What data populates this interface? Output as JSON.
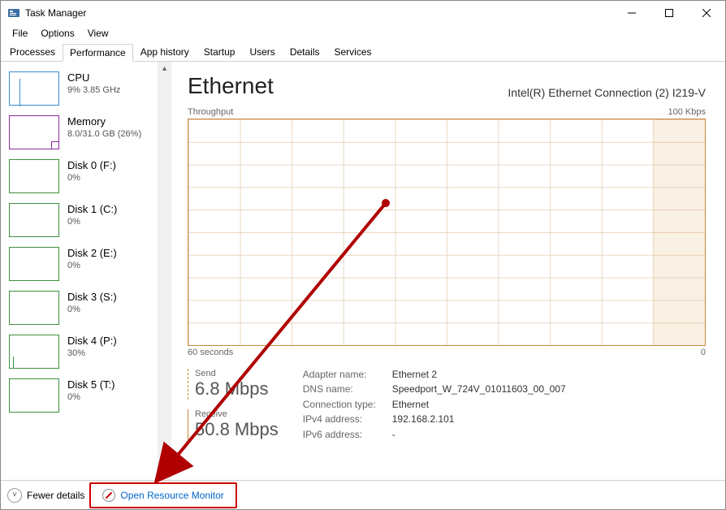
{
  "window": {
    "title": "Task Manager",
    "menus": [
      "File",
      "Options",
      "View"
    ],
    "tabs": [
      "Processes",
      "Performance",
      "App history",
      "Startup",
      "Users",
      "Details",
      "Services"
    ],
    "active_tab": "Performance"
  },
  "sidebar": {
    "items": [
      {
        "title": "CPU",
        "sub": "9% 3.85 GHz",
        "kind": "cpu"
      },
      {
        "title": "Memory",
        "sub": "8.0/31.0 GB (26%)",
        "kind": "mem"
      },
      {
        "title": "Disk 0 (F:)",
        "sub": "0%",
        "kind": "disk"
      },
      {
        "title": "Disk 1 (C:)",
        "sub": "0%",
        "kind": "disk"
      },
      {
        "title": "Disk 2 (E:)",
        "sub": "0%",
        "kind": "disk"
      },
      {
        "title": "Disk 3 (S:)",
        "sub": "0%",
        "kind": "disk"
      },
      {
        "title": "Disk 4 (P:)",
        "sub": "30%",
        "kind": "disk4"
      },
      {
        "title": "Disk 5 (T:)",
        "sub": "0%",
        "kind": "disk"
      }
    ]
  },
  "main": {
    "title": "Ethernet",
    "subtitle": "Intel(R) Ethernet Connection (2) I219-V",
    "chart_top_left": "Throughput",
    "chart_top_right": "100 Kbps",
    "chart_bottom_left": "60 seconds",
    "chart_bottom_right": "0",
    "send_label": "Send",
    "send_value": "6.8 Mbps",
    "receive_label": "Receive",
    "receive_value": "50.8 Mbps",
    "details": {
      "adapter_k": "Adapter name:",
      "adapter_v": "Ethernet 2",
      "dns_k": "DNS name:",
      "dns_v": "Speedport_W_724V_01011603_00_007",
      "conn_k": "Connection type:",
      "conn_v": "Ethernet",
      "ipv4_k": "IPv4 address:",
      "ipv4_v": "192.168.2.101",
      "ipv6_k": "IPv6 address:",
      "ipv6_v": "-"
    }
  },
  "footer": {
    "fewer": "Fewer details",
    "resmon": "Open Resource Monitor"
  },
  "chart_data": {
    "type": "line",
    "title": "Throughput",
    "xlabel": "seconds",
    "ylabel": "Kbps",
    "xlim": [
      0,
      60
    ],
    "ylim": [
      0,
      100
    ],
    "series": [
      {
        "name": "Send",
        "color": "#c98a3f",
        "style": "dashed",
        "values": []
      },
      {
        "name": "Receive",
        "color": "#c98a3f",
        "style": "solid",
        "values": []
      }
    ],
    "note": "Chart area visible but data line near zero / not distinguishable in screenshot"
  }
}
